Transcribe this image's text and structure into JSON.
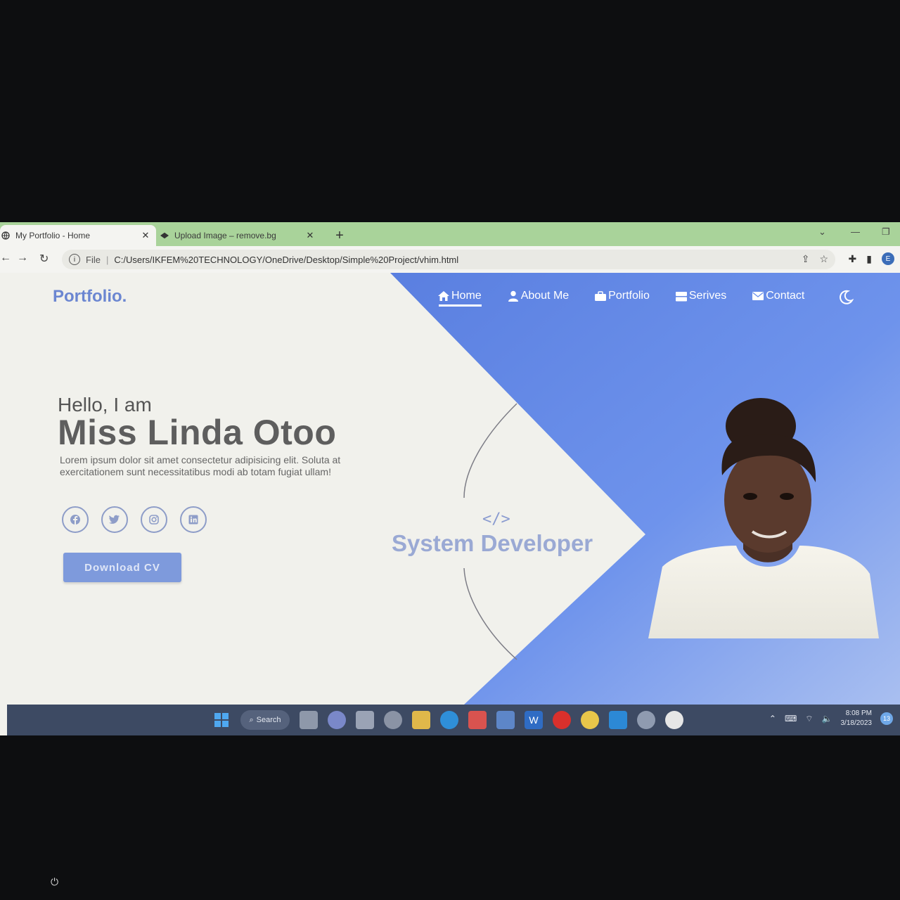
{
  "browser": {
    "tabs": [
      {
        "label": "My Portfolio - Home",
        "icon": "globe-icon",
        "active": true
      },
      {
        "label": "Upload Image – remove.bg",
        "icon": "removebg-icon",
        "active": false
      }
    ],
    "new_tab": "+",
    "address": {
      "scheme": "File",
      "url": "C:/Users/IKFEM%20TECHNOLOGY/OneDrive/Desktop/Simple%20Project/vhim.html"
    },
    "profile_initial": "E"
  },
  "site": {
    "brand": "Portfolio",
    "brand_dot": ".",
    "nav": [
      {
        "label": "Home",
        "icon": "home-icon",
        "active": true
      },
      {
        "label": "About Me",
        "icon": "user-icon",
        "active": false
      },
      {
        "label": "Portfolio",
        "icon": "briefcase-icon",
        "active": false
      },
      {
        "label": "Serives",
        "icon": "server-icon",
        "active": false
      },
      {
        "label": "Contact",
        "icon": "envelope-icon",
        "active": false
      }
    ],
    "theme_toggle_icon": "moon-icon"
  },
  "hero": {
    "greeting": "Hello, I am",
    "name": "Miss Linda Otoo",
    "bio": "Lorem ipsum dolor sit amet consectetur adipisicing elit. Soluta at exercitationem sunt necessitatibus modi ab totam fugiat ullam!",
    "socials": [
      "facebook-icon",
      "twitter-icon",
      "instagram-icon",
      "linkedin-icon"
    ],
    "cta": "Download CV",
    "code_glyph": "</>",
    "role": "System Developer"
  },
  "taskbar": {
    "search_label": "Search",
    "time": "8:08 PM",
    "date": "3/18/2023",
    "notification_count": "13"
  },
  "colors": {
    "accent": "#6b86d1",
    "panel_blue": "#5b83e6",
    "page_bg": "#f1f1ec",
    "taskbar": "#3d4a63"
  }
}
